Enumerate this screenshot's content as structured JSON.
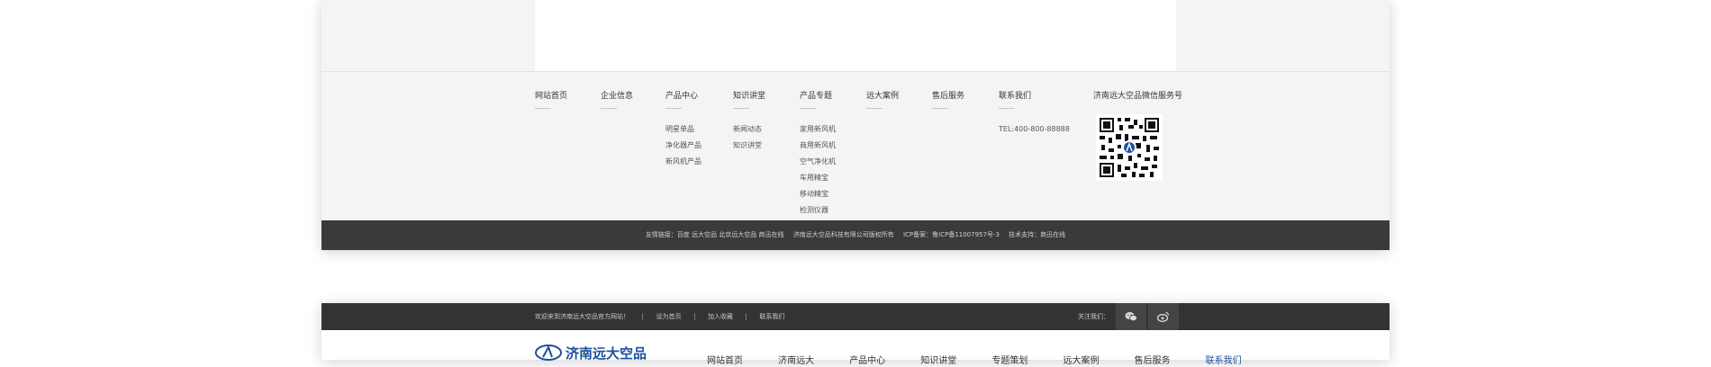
{
  "footer": {
    "columns": [
      {
        "title": "网站首页",
        "links": []
      },
      {
        "title": "企业信息",
        "links": []
      },
      {
        "title": "产品中心",
        "links": [
          "明星单品",
          "净化器产品",
          "新风机产品"
        ]
      },
      {
        "title": "知识讲堂",
        "links": [
          "新闻动态",
          "知识讲堂"
        ]
      },
      {
        "title": "产品专题",
        "links": [
          "家用新风机",
          "商用新风机",
          "空气净化机",
          "车用精宝",
          "移动精宝",
          "检测仪器"
        ]
      },
      {
        "title": "远大案例",
        "links": []
      },
      {
        "title": "售后服务",
        "links": []
      },
      {
        "title": "联系我们",
        "links": []
      }
    ],
    "tel": "TEL:400-800-88888",
    "wechat_title": "济南远大空品微信服务号",
    "bottom_bar": {
      "friendly_links": "友情链接：百度 远大空品 北京远大空品 商迅在线",
      "copyright": "济南远大空品科技有限公司版权所有",
      "icp": "ICP备案：鲁ICP备11007957号-3",
      "support": "技术支持：商迅在线"
    }
  },
  "header": {
    "topbar": {
      "welcome": "欢迎来到济南远大空品官方网站！",
      "set_home": "设为首页",
      "bookmark": "加入收藏",
      "contact": "联系我们",
      "follow_label": "关注我们："
    },
    "icons": {
      "wechat": "wechat-icon",
      "weibo": "weibo-icon"
    },
    "logo_text": "济南远大空品",
    "nav": [
      "网站首页",
      "济南远大",
      "产品中心",
      "知识讲堂",
      "专题策划",
      "远大案例",
      "售后服务",
      "联系我们"
    ],
    "nav_active_index": 7
  },
  "colors": {
    "accent": "#1d4fa0",
    "footer_bar": "#3a3a3a",
    "topbar": "#333333"
  }
}
